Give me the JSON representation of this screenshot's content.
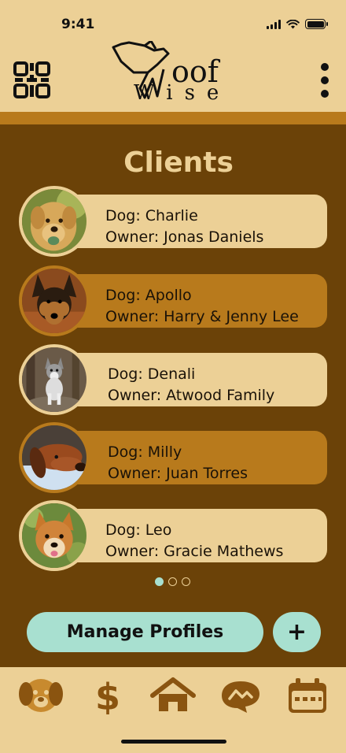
{
  "status_bar": {
    "time": "9:41"
  },
  "header": {
    "logo_top": "oof",
    "logo_bottom": "Wise",
    "colors": {
      "header_bg": "#ecd096",
      "accent": "#b87a1c",
      "page_bg": "#6b4208",
      "button": "#a8e0d0"
    }
  },
  "page": {
    "title": "Clients"
  },
  "clients": [
    {
      "dog": "Dog: Charlie",
      "owner": "Owner: Jonas Daniels"
    },
    {
      "dog": "Dog: Apollo",
      "owner": "Owner: Harry & Jenny Lee"
    },
    {
      "dog": "Dog: Denali",
      "owner": "Owner: Atwood Family"
    },
    {
      "dog": "Dog: Milly",
      "owner": "Owner: Juan Torres"
    },
    {
      "dog": "Dog: Leo",
      "owner": "Owner: Gracie Mathews"
    }
  ],
  "pagination": {
    "total": 3,
    "active_page": 1
  },
  "actions": {
    "manage_label": "Manage Profiles",
    "add_label": "+"
  },
  "tabs": [
    {
      "icon": "dog-face-icon"
    },
    {
      "icon": "dollar-icon"
    },
    {
      "icon": "home-icon"
    },
    {
      "icon": "chat-bubble-icon"
    },
    {
      "icon": "calendar-icon"
    }
  ]
}
